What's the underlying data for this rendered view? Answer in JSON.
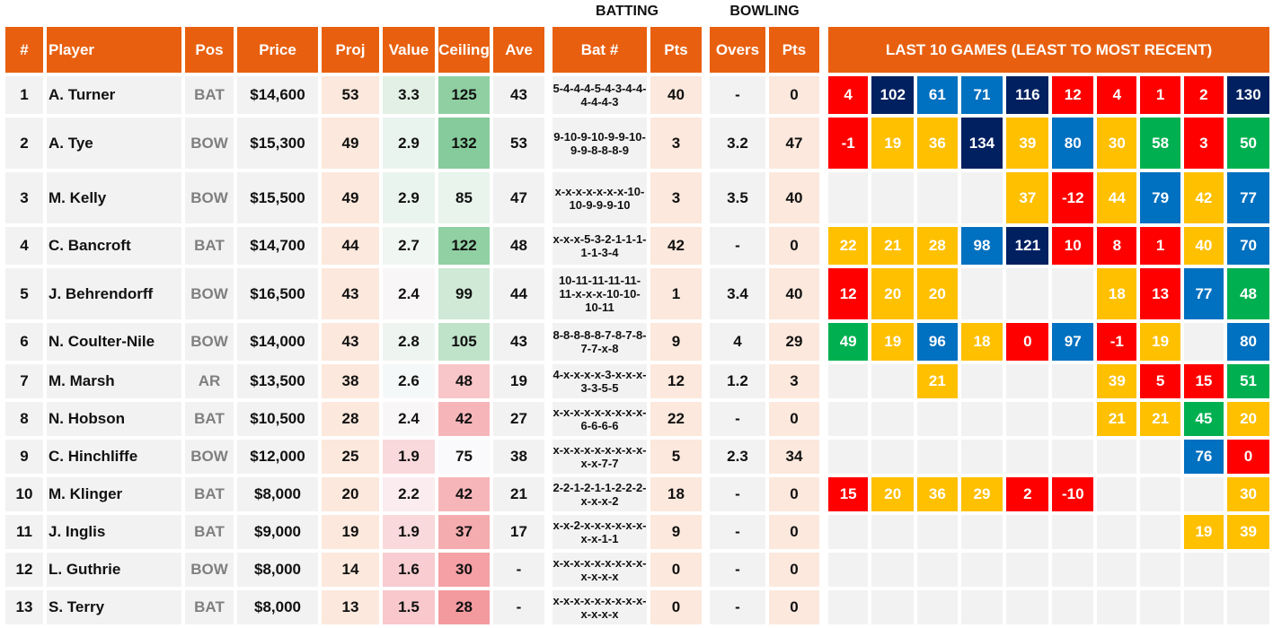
{
  "group_labels": {
    "batting": "BATTING",
    "bowling": "BOWLING"
  },
  "headers": {
    "num": "#",
    "player": "Player",
    "pos": "Pos",
    "price": "Price",
    "proj": "Proj",
    "value": "Value",
    "ceiling": "Ceiling",
    "ave": "Ave",
    "bat_num": "Bat #",
    "bat_pts": "Pts",
    "overs": "Overs",
    "bowl_pts": "Pts",
    "last10": "LAST 10 GAMES (LEAST TO MOST RECENT)"
  },
  "colors": {
    "header": "#e8600f",
    "game_red": "#ff0000",
    "game_yellow": "#ffc000",
    "game_blue": "#0070c0",
    "game_navy": "#002060",
    "game_green": "#00b050",
    "game_empty": "#f2f2f2"
  },
  "players": [
    {
      "num": "1",
      "name": "A. Turner",
      "pos": "BAT",
      "price": "$14,600",
      "proj": "53",
      "value": "3.3",
      "value_bg": "#e2f0e6",
      "ceiling": "125",
      "ceiling_bg": "#8fcfa2",
      "ave": "43",
      "bat_num": "5-4-4-4-5-4-3-4-4-4-4-4-3",
      "bat_pts": "40",
      "overs": "-",
      "bowl_pts": "0",
      "games": [
        {
          "v": "4",
          "c": "red"
        },
        {
          "v": "102",
          "c": "navy"
        },
        {
          "v": "61",
          "c": "blue"
        },
        {
          "v": "71",
          "c": "blue"
        },
        {
          "v": "116",
          "c": "navy"
        },
        {
          "v": "12",
          "c": "red"
        },
        {
          "v": "4",
          "c": "red"
        },
        {
          "v": "1",
          "c": "red"
        },
        {
          "v": "2",
          "c": "red"
        },
        {
          "v": "130",
          "c": "navy"
        }
      ]
    },
    {
      "num": "2",
      "name": "A. Tye",
      "pos": "BOW",
      "price": "$15,300",
      "proj": "49",
      "value": "2.9",
      "value_bg": "#eaf4ee",
      "ceiling": "132",
      "ceiling_bg": "#86cb9b",
      "ave": "53",
      "bat_num": "9-10-9-10-9-9-10-9-9-8-8-8-9",
      "bat_pts": "3",
      "overs": "3.2",
      "bowl_pts": "47",
      "games": [
        {
          "v": "-1",
          "c": "red"
        },
        {
          "v": "19",
          "c": "yellow"
        },
        {
          "v": "36",
          "c": "yellow"
        },
        {
          "v": "134",
          "c": "navy"
        },
        {
          "v": "39",
          "c": "yellow"
        },
        {
          "v": "80",
          "c": "blue"
        },
        {
          "v": "30",
          "c": "yellow"
        },
        {
          "v": "58",
          "c": "green"
        },
        {
          "v": "3",
          "c": "red"
        },
        {
          "v": "50",
          "c": "green"
        }
      ]
    },
    {
      "num": "3",
      "name": "M. Kelly",
      "pos": "BOW",
      "price": "$15,500",
      "proj": "49",
      "value": "2.9",
      "value_bg": "#eaf4ee",
      "ceiling": "85",
      "ceiling_bg": "#e8f4ec",
      "ave": "47",
      "bat_num": "x-x-x-x-x-x-x-10-10-9-9-9-10",
      "bat_pts": "3",
      "overs": "3.5",
      "bowl_pts": "40",
      "games": [
        {
          "v": "",
          "c": "empty"
        },
        {
          "v": "",
          "c": "empty"
        },
        {
          "v": "",
          "c": "empty"
        },
        {
          "v": "",
          "c": "empty"
        },
        {
          "v": "37",
          "c": "yellow"
        },
        {
          "v": "-12",
          "c": "red"
        },
        {
          "v": "44",
          "c": "yellow"
        },
        {
          "v": "79",
          "c": "blue"
        },
        {
          "v": "42",
          "c": "yellow"
        },
        {
          "v": "77",
          "c": "blue"
        }
      ]
    },
    {
      "num": "4",
      "name": "C. Bancroft",
      "pos": "BAT",
      "price": "$14,700",
      "proj": "44",
      "value": "2.7",
      "value_bg": "#f0f6f2",
      "ceiling": "122",
      "ceiling_bg": "#90d0a3",
      "ave": "48",
      "bat_num": "x-x-x-5-3-2-1-1-1-1-1-3-4",
      "bat_pts": "42",
      "overs": "-",
      "bowl_pts": "0",
      "games": [
        {
          "v": "22",
          "c": "yellow"
        },
        {
          "v": "21",
          "c": "yellow"
        },
        {
          "v": "28",
          "c": "yellow"
        },
        {
          "v": "98",
          "c": "blue"
        },
        {
          "v": "121",
          "c": "navy"
        },
        {
          "v": "10",
          "c": "red"
        },
        {
          "v": "8",
          "c": "red"
        },
        {
          "v": "1",
          "c": "red"
        },
        {
          "v": "40",
          "c": "yellow"
        },
        {
          "v": "70",
          "c": "blue"
        }
      ]
    },
    {
      "num": "5",
      "name": "J. Behrendorff",
      "pos": "BOW",
      "price": "$16,500",
      "proj": "43",
      "value": "2.4",
      "value_bg": "#f9f6f8",
      "ceiling": "99",
      "ceiling_bg": "#cfe9d6",
      "ave": "44",
      "bat_num": "10-11-11-11-11-11-x-x-x-10-10-10-11",
      "bat_pts": "1",
      "overs": "3.4",
      "bowl_pts": "40",
      "games": [
        {
          "v": "12",
          "c": "red"
        },
        {
          "v": "20",
          "c": "yellow"
        },
        {
          "v": "20",
          "c": "yellow"
        },
        {
          "v": "",
          "c": "empty"
        },
        {
          "v": "",
          "c": "empty"
        },
        {
          "v": "",
          "c": "empty"
        },
        {
          "v": "18",
          "c": "yellow"
        },
        {
          "v": "13",
          "c": "red"
        },
        {
          "v": "77",
          "c": "blue"
        },
        {
          "v": "48",
          "c": "green"
        }
      ]
    },
    {
      "num": "6",
      "name": "N. Coulter-Nile",
      "pos": "BOW",
      "price": "$14,000",
      "proj": "43",
      "value": "2.8",
      "value_bg": "#eef5f0",
      "ceiling": "105",
      "ceiling_bg": "#bfe3c9",
      "ave": "43",
      "bat_num": "8-8-8-8-8-7-8-7-8-7-7-x-8",
      "bat_pts": "9",
      "overs": "4",
      "bowl_pts": "29",
      "games": [
        {
          "v": "49",
          "c": "green"
        },
        {
          "v": "19",
          "c": "yellow"
        },
        {
          "v": "96",
          "c": "blue"
        },
        {
          "v": "18",
          "c": "yellow"
        },
        {
          "v": "0",
          "c": "red"
        },
        {
          "v": "97",
          "c": "blue"
        },
        {
          "v": "-1",
          "c": "red"
        },
        {
          "v": "19",
          "c": "yellow"
        },
        {
          "v": "",
          "c": "empty"
        },
        {
          "v": "80",
          "c": "blue"
        }
      ]
    },
    {
      "num": "7",
      "name": "M. Marsh",
      "pos": "AR",
      "price": "$13,500",
      "proj": "38",
      "value": "2.6",
      "value_bg": "#f5f8f8",
      "ceiling": "48",
      "ceiling_bg": "#f8c6c8",
      "ave": "19",
      "bat_num": "4-x-x-x-x-3-x-x-x-3-3-5-5",
      "bat_pts": "12",
      "overs": "1.2",
      "bowl_pts": "3",
      "games": [
        {
          "v": "",
          "c": "empty"
        },
        {
          "v": "",
          "c": "empty"
        },
        {
          "v": "21",
          "c": "yellow"
        },
        {
          "v": "",
          "c": "empty"
        },
        {
          "v": "",
          "c": "empty"
        },
        {
          "v": "",
          "c": "empty"
        },
        {
          "v": "39",
          "c": "yellow"
        },
        {
          "v": "5",
          "c": "red"
        },
        {
          "v": "15",
          "c": "red"
        },
        {
          "v": "51",
          "c": "green"
        }
      ]
    },
    {
      "num": "8",
      "name": "N. Hobson",
      "pos": "BAT",
      "price": "$10,500",
      "proj": "28",
      "value": "2.4",
      "value_bg": "#f9f6f8",
      "ceiling": "42",
      "ceiling_bg": "#f6b6b9",
      "ave": "27",
      "bat_num": "x-x-x-x-x-x-x-x-x-6-6-6-6",
      "bat_pts": "22",
      "overs": "-",
      "bowl_pts": "0",
      "games": [
        {
          "v": "",
          "c": "empty"
        },
        {
          "v": "",
          "c": "empty"
        },
        {
          "v": "",
          "c": "empty"
        },
        {
          "v": "",
          "c": "empty"
        },
        {
          "v": "",
          "c": "empty"
        },
        {
          "v": "",
          "c": "empty"
        },
        {
          "v": "21",
          "c": "yellow"
        },
        {
          "v": "21",
          "c": "yellow"
        },
        {
          "v": "45",
          "c": "green"
        },
        {
          "v": "20",
          "c": "yellow"
        }
      ]
    },
    {
      "num": "9",
      "name": "C. Hinchliffe",
      "pos": "BOW",
      "price": "$12,000",
      "proj": "25",
      "value": "1.9",
      "value_bg": "#f9d9dc",
      "ceiling": "75",
      "ceiling_bg": "#faf9fb",
      "ave": "38",
      "bat_num": "x-x-x-x-x-x-x-x-x-x-x-7-7",
      "bat_pts": "5",
      "overs": "2.3",
      "bowl_pts": "34",
      "games": [
        {
          "v": "",
          "c": "empty"
        },
        {
          "v": "",
          "c": "empty"
        },
        {
          "v": "",
          "c": "empty"
        },
        {
          "v": "",
          "c": "empty"
        },
        {
          "v": "",
          "c": "empty"
        },
        {
          "v": "",
          "c": "empty"
        },
        {
          "v": "",
          "c": "empty"
        },
        {
          "v": "",
          "c": "empty"
        },
        {
          "v": "76",
          "c": "blue"
        },
        {
          "v": "0",
          "c": "red"
        }
      ]
    },
    {
      "num": "10",
      "name": "M. Klinger",
      "pos": "BAT",
      "price": "$8,000",
      "proj": "20",
      "value": "2.2",
      "value_bg": "#fbecef",
      "ceiling": "42",
      "ceiling_bg": "#f6b6b9",
      "ave": "21",
      "bat_num": "2-2-1-2-1-1-2-2-2-x-x-x-2",
      "bat_pts": "18",
      "overs": "-",
      "bowl_pts": "0",
      "games": [
        {
          "v": "15",
          "c": "red"
        },
        {
          "v": "20",
          "c": "yellow"
        },
        {
          "v": "36",
          "c": "yellow"
        },
        {
          "v": "29",
          "c": "yellow"
        },
        {
          "v": "2",
          "c": "red"
        },
        {
          "v": "-10",
          "c": "red"
        },
        {
          "v": "",
          "c": "empty"
        },
        {
          "v": "",
          "c": "empty"
        },
        {
          "v": "",
          "c": "empty"
        },
        {
          "v": "30",
          "c": "yellow"
        }
      ]
    },
    {
      "num": "11",
      "name": "J. Inglis",
      "pos": "BAT",
      "price": "$9,000",
      "proj": "19",
      "value": "1.9",
      "value_bg": "#f9d9dc",
      "ceiling": "37",
      "ceiling_bg": "#f5acaf",
      "ave": "17",
      "bat_num": "x-x-2-x-x-x-x-x-x-x-x-1-1",
      "bat_pts": "9",
      "overs": "-",
      "bowl_pts": "0",
      "games": [
        {
          "v": "",
          "c": "empty"
        },
        {
          "v": "",
          "c": "empty"
        },
        {
          "v": "",
          "c": "empty"
        },
        {
          "v": "",
          "c": "empty"
        },
        {
          "v": "",
          "c": "empty"
        },
        {
          "v": "",
          "c": "empty"
        },
        {
          "v": "",
          "c": "empty"
        },
        {
          "v": "",
          "c": "empty"
        },
        {
          "v": "19",
          "c": "yellow"
        },
        {
          "v": "39",
          "c": "yellow"
        }
      ]
    },
    {
      "num": "12",
      "name": "L. Guthrie",
      "pos": "BOW",
      "price": "$8,000",
      "proj": "14",
      "value": "1.6",
      "value_bg": "#f8ccd0",
      "ceiling": "30",
      "ceiling_bg": "#f4a0a4",
      "ave": "-",
      "bat_num": "x-x-x-x-x-x-x-x-x-x-x-x-x",
      "bat_pts": "0",
      "overs": "-",
      "bowl_pts": "0",
      "games": [
        {
          "v": "",
          "c": "empty"
        },
        {
          "v": "",
          "c": "empty"
        },
        {
          "v": "",
          "c": "empty"
        },
        {
          "v": "",
          "c": "empty"
        },
        {
          "v": "",
          "c": "empty"
        },
        {
          "v": "",
          "c": "empty"
        },
        {
          "v": "",
          "c": "empty"
        },
        {
          "v": "",
          "c": "empty"
        },
        {
          "v": "",
          "c": "empty"
        },
        {
          "v": "",
          "c": "empty"
        }
      ]
    },
    {
      "num": "13",
      "name": "S. Terry",
      "pos": "BAT",
      "price": "$8,000",
      "proj": "13",
      "value": "1.5",
      "value_bg": "#f8c8cc",
      "ceiling": "28",
      "ceiling_bg": "#f39a9f",
      "ave": "-",
      "bat_num": "x-x-x-x-x-x-x-x-x-x-x-x-x",
      "bat_pts": "0",
      "overs": "-",
      "bowl_pts": "0",
      "games": [
        {
          "v": "",
          "c": "empty"
        },
        {
          "v": "",
          "c": "empty"
        },
        {
          "v": "",
          "c": "empty"
        },
        {
          "v": "",
          "c": "empty"
        },
        {
          "v": "",
          "c": "empty"
        },
        {
          "v": "",
          "c": "empty"
        },
        {
          "v": "",
          "c": "empty"
        },
        {
          "v": "",
          "c": "empty"
        },
        {
          "v": "",
          "c": "empty"
        },
        {
          "v": "",
          "c": "empty"
        }
      ]
    }
  ]
}
